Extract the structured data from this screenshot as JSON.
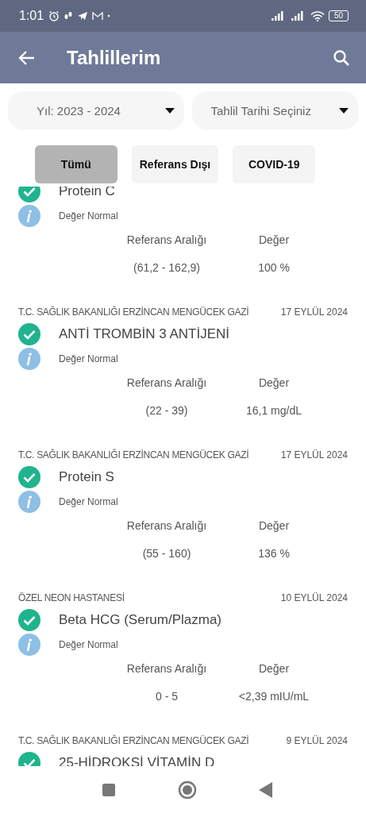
{
  "status_bar": {
    "time": "1:01",
    "battery": "50"
  },
  "app_bar": {
    "title": "Tahlillerim"
  },
  "filters": [
    {
      "label": "Yıl: 2023 - 2024"
    },
    {
      "label": "Tahlil Tarihi Seçiniz"
    }
  ],
  "chips": [
    {
      "label": "Tümü",
      "selected": true
    },
    {
      "label": "Referans Dışı",
      "selected": false
    },
    {
      "label": "COVID-19",
      "selected": false
    }
  ],
  "results": [
    {
      "name": "Protein C",
      "status": "Değer Normal",
      "range_label": "Referans Aralığı",
      "value_label": "Değer",
      "range": "(61,2 - 162,9)",
      "value": "100 %"
    },
    {
      "source": "T.C. SAĞLIK BAKANLIĞI ERZİNCAN MENGÜCEK GAZİ",
      "date": "17 EYLÜL 2024",
      "name": "ANTİ TROMBİN 3 ANTİJENİ",
      "status": "Değer Normal",
      "range_label": "Referans Aralığı",
      "value_label": "Değer",
      "range": "(22 - 39)",
      "value": "16,1 mg/dL"
    },
    {
      "source": "T.C. SAĞLIK BAKANLIĞI ERZİNCAN MENGÜCEK GAZİ",
      "date": "17 EYLÜL 2024",
      "name": "Protein S",
      "status": "Değer Normal",
      "range_label": "Referans Aralığı",
      "value_label": "Değer",
      "range": "(55 - 160)",
      "value": "136 %"
    },
    {
      "source": "ÖZEL NEON HASTANESİ",
      "date": "10 EYLÜL 2024",
      "name": "Beta HCG (Serum/Plazma)",
      "status": "Değer Normal",
      "range_label": "Referans Aralığı",
      "value_label": "Değer",
      "range": "0 - 5",
      "value": "<2,39 mIU/mL"
    },
    {
      "source": "T.C. SAĞLIK BAKANLIĞI ERZİNCAN MENGÜCEK GAZİ",
      "date": "9 EYLÜL 2024",
      "name": "25-HİDROKSİ VİTAMİN D"
    }
  ]
}
